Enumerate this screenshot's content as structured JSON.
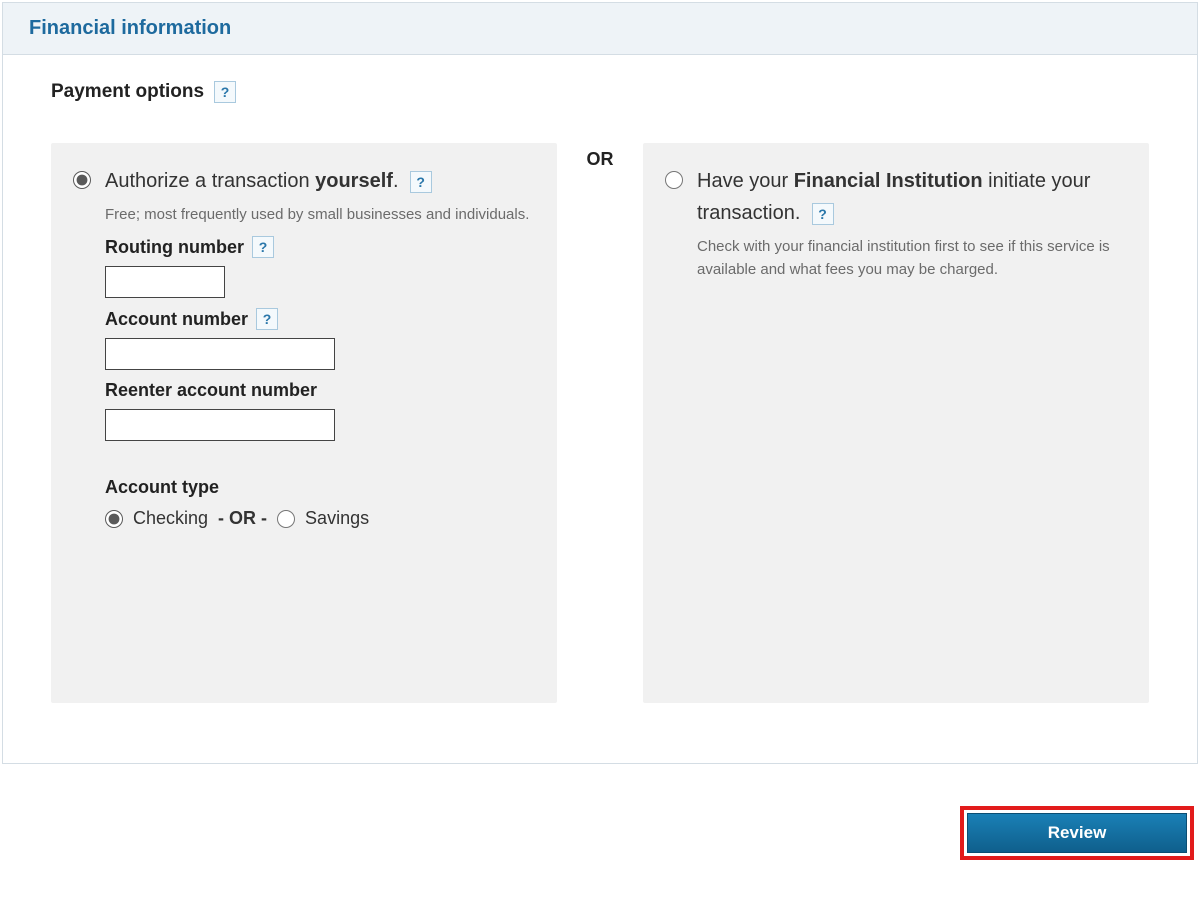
{
  "panel": {
    "title": "Financial information"
  },
  "payment": {
    "heading": "Payment options",
    "help_glyph": "?",
    "or_label": "OR",
    "option_a": {
      "radio_checked": true,
      "title_part1": "Authorize a transaction ",
      "title_bold": "yourself",
      "title_after": ".",
      "desc": "Free; most frequently used by small businesses and individuals.",
      "routing_label": "Routing number",
      "routing_value": "",
      "account_label": "Account number",
      "account_value": "",
      "reenter_label": "Reenter account number",
      "reenter_value": "",
      "account_type_label": "Account type",
      "checking_label": "Checking",
      "interior_or": "- OR -",
      "savings_label": "Savings",
      "checking_checked": true,
      "savings_checked": false
    },
    "option_b": {
      "radio_checked": false,
      "title_part1": "Have your ",
      "title_bold": "Financial Institution",
      "title_part2": " initiate your transaction.",
      "desc": "Check with your financial institution first to see if this service is available and what fees you may be charged."
    }
  },
  "footer": {
    "review_label": "Review"
  }
}
